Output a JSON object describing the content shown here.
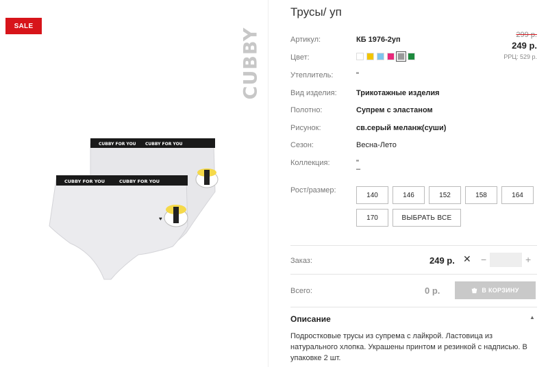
{
  "badge": {
    "sale": "SALE"
  },
  "brand": "CUBBY",
  "product": {
    "title": "Трусы/ уп"
  },
  "attributes": [
    {
      "label": "Артикул:",
      "value": "КБ 1976-2уп"
    },
    {
      "label": "Цвет:",
      "value": ""
    },
    {
      "label": "Утеплитель:",
      "value": "\""
    },
    {
      "label": "Вид изделия:",
      "value": "Трикотажные изделия"
    },
    {
      "label": "Полотно:",
      "value": "Супрем с эластаном"
    },
    {
      "label": "Рисунок:",
      "value": "св.серый меланж(суши)"
    },
    {
      "label": "Сезон:",
      "value": "Весна-Лето"
    },
    {
      "label": "Коллекция:",
      "value": "\""
    },
    {
      "label": "Рост/размер:",
      "value": ""
    }
  ],
  "collection_extra": "–",
  "price": {
    "old": "299 р.",
    "new": "249 р.",
    "rrp": "РРЦ: 529 р."
  },
  "colors": [
    "#ffffff",
    "#f2c500",
    "#7ec4ec",
    "#e8287a",
    "#9a9a9a",
    "#1e8a3e"
  ],
  "selected_color_index": 4,
  "sizes": [
    "140",
    "146",
    "152",
    "158",
    "164",
    "170"
  ],
  "select_all_label": "ВЫБРАТЬ ВСЕ",
  "order": {
    "label": "Заказ:",
    "price": "249 р.",
    "remove": "✕",
    "minus": "−",
    "plus": "+",
    "quantity": ""
  },
  "total": {
    "label": "Всего:",
    "value": "0 р."
  },
  "cart_button": "В КОРЗИНУ",
  "description": {
    "title": "Описание",
    "text": "Подростковые трусы из супрема с лайкрой. Ластовица из натурального хлопка. Украшены принтом и резинкой с надписью. В упаковке 2 шт."
  },
  "print_text": "CUBBY FOR YOU"
}
